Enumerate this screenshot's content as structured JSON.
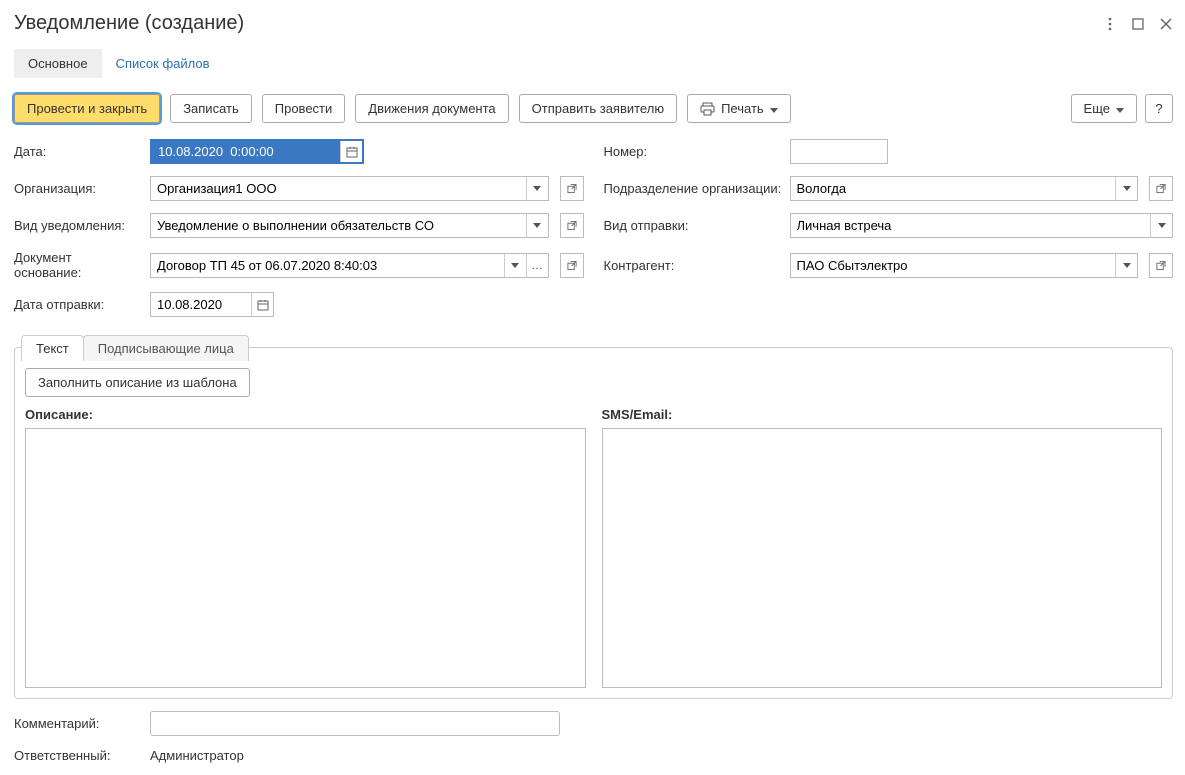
{
  "title": "Уведомление (создание)",
  "nav": {
    "main": "Основное",
    "files": "Список файлов"
  },
  "toolbar": {
    "post_close": "Провести и закрыть",
    "save": "Записать",
    "post": "Провести",
    "movements": "Движения документа",
    "send": "Отправить заявителю",
    "print": "Печать",
    "more": "Еще",
    "help": "?"
  },
  "fields": {
    "date_label": "Дата:",
    "date_value": "10.08.2020  0:00:00",
    "number_label": "Номер:",
    "number_value": "",
    "org_label": "Организация:",
    "org_value": "Организация1 ООО",
    "dept_label": "Подразделение организации:",
    "dept_value": "Вологда",
    "notif_type_label": "Вид уведомления:",
    "notif_type_value": "Уведомление о выполнении обязательств СО",
    "send_type_label": "Вид отправки:",
    "send_type_value": "Личная встреча",
    "basis_label": "Документ основание:",
    "basis_value": "Договор ТП 45 от 06.07.2020 8:40:03",
    "counterparty_label": "Контрагент:",
    "counterparty_value": "ПАО Сбытэлектро",
    "send_date_label": "Дата отправки:",
    "send_date_value": "10.08.2020"
  },
  "tabs": {
    "text": "Текст",
    "signers": "Подписывающие лица"
  },
  "text_tab": {
    "fill_from_template": "Заполнить описание из шаблона",
    "desc_label": "Описание:",
    "sms_label": "SMS/Email:"
  },
  "footer": {
    "comment_label": "Комментарий:",
    "comment_value": "",
    "responsible_label": "Ответственный:",
    "responsible_value": "Администратор"
  }
}
